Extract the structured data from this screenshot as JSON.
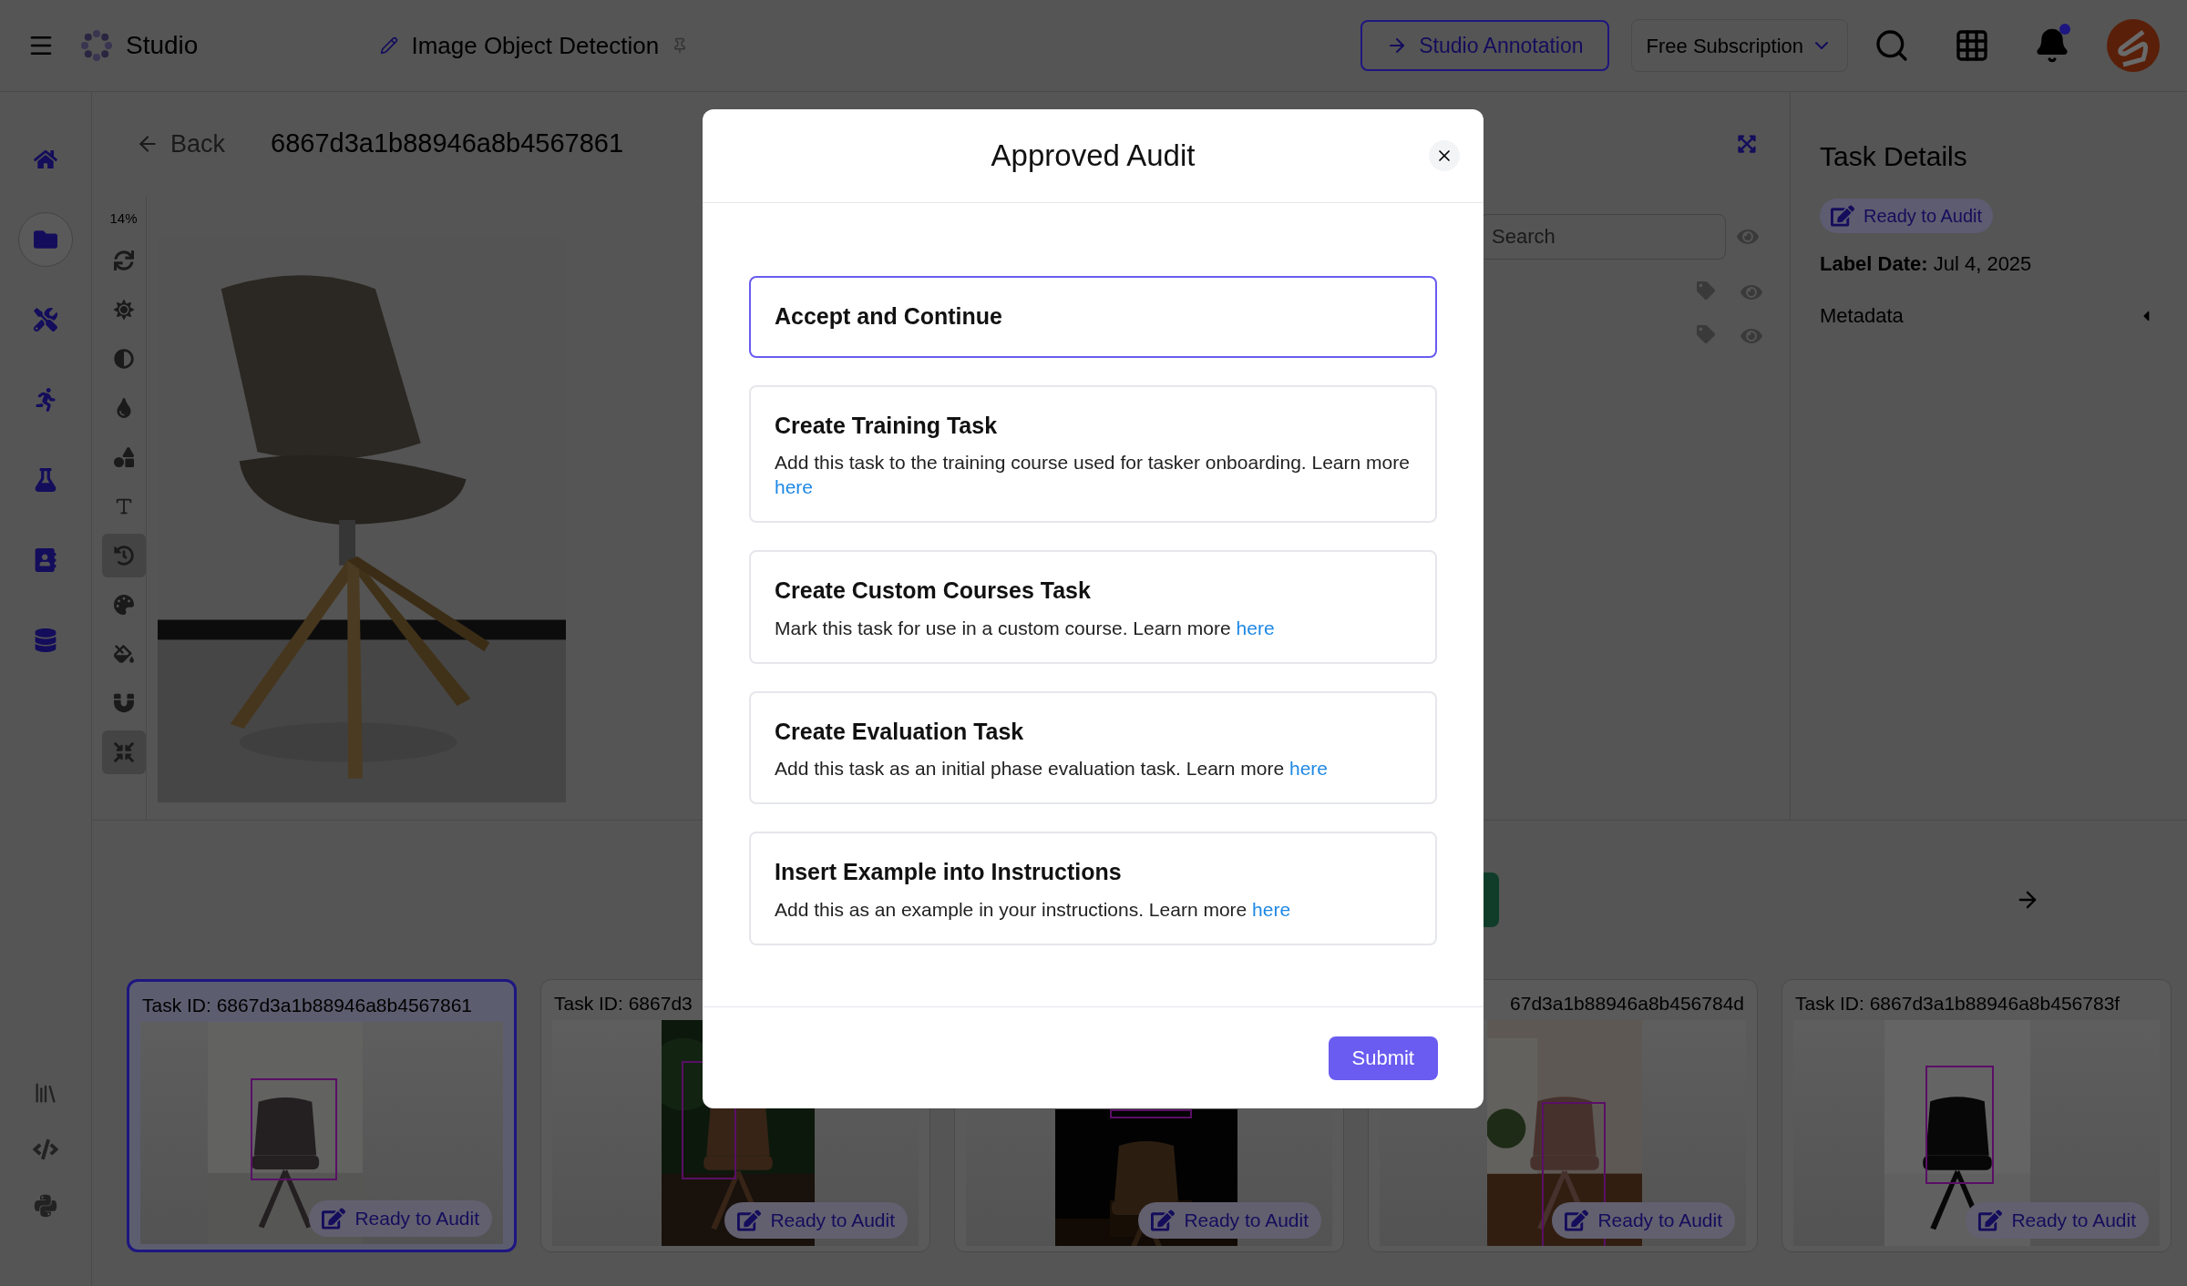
{
  "top_bar": {
    "app_name": "Studio",
    "project_title": "Image Object Detection",
    "annotation_button": "Studio Annotation",
    "subscription": "Free Subscription",
    "notifications_unread": true
  },
  "nav": {
    "items": [
      {
        "selected": false
      },
      {
        "selected": true
      },
      {
        "selected": false
      },
      {
        "selected": false
      },
      {
        "selected": false
      },
      {
        "selected": false
      },
      {
        "selected": false
      }
    ]
  },
  "header": {
    "back": "Back",
    "task_id": "6867d3a1b88946a8b4567861"
  },
  "toolbar": {
    "zoom": "14%",
    "tools": [
      {
        "selected": false
      },
      {
        "selected": false
      },
      {
        "selected": false
      },
      {
        "selected": false
      },
      {
        "selected": false
      },
      {
        "selected": false
      },
      {
        "selected": true
      },
      {
        "selected": false
      },
      {
        "selected": false
      },
      {
        "selected": false
      },
      {
        "selected": true
      }
    ]
  },
  "layers": {
    "search": {
      "placeholder": "Search"
    }
  },
  "task_details": {
    "title": "Task Details",
    "status": "Ready to Audit",
    "label_date": "**Label Date:** Jul 4, 2025",
    "metadata": "Metadata",
    "metadata_expanded": false
  },
  "thumbnails": [
    {
      "task_id": "Task ID: 6867d3a1b88946a8b4567861",
      "status": "Ready to Audit",
      "selected": true
    },
    {
      "task_id": "Task ID: 6867d3",
      "status": "Ready to Audit",
      "selected": false
    },
    {
      "status": "Ready to Audit",
      "selected": false
    },
    {
      "task_id": "67d3a1b88946a8b456784d",
      "status": "Ready to Audit",
      "selected": false
    },
    {
      "task_id": "Task ID: 6867d3a1b88946a8b456783f",
      "status": "Ready to Audit",
      "selected": false
    }
  ],
  "dialog": {
    "title": "Approved Audit",
    "options": [
      {
        "title": "Accept and Continue",
        "selected": true
      },
      {
        "title": "Create Training Task",
        "description": "Add this task to the training course used for tasker onboarding. Learn more",
        "link": "here",
        "selected": false
      },
      {
        "title": "Create Custom Courses Task",
        "description": "Mark this task for use in a custom course. Learn more",
        "link": "here",
        "selected": false
      },
      {
        "title": "Create Evaluation Task",
        "description": "Add this task as an initial phase evaluation task. Learn more",
        "link": "here",
        "selected": false
      },
      {
        "title": "Insert Example into Instructions",
        "description": "Add this as an example in your instructions. Learn more",
        "link": "here",
        "selected": false
      }
    ],
    "submit": "Submit"
  }
}
